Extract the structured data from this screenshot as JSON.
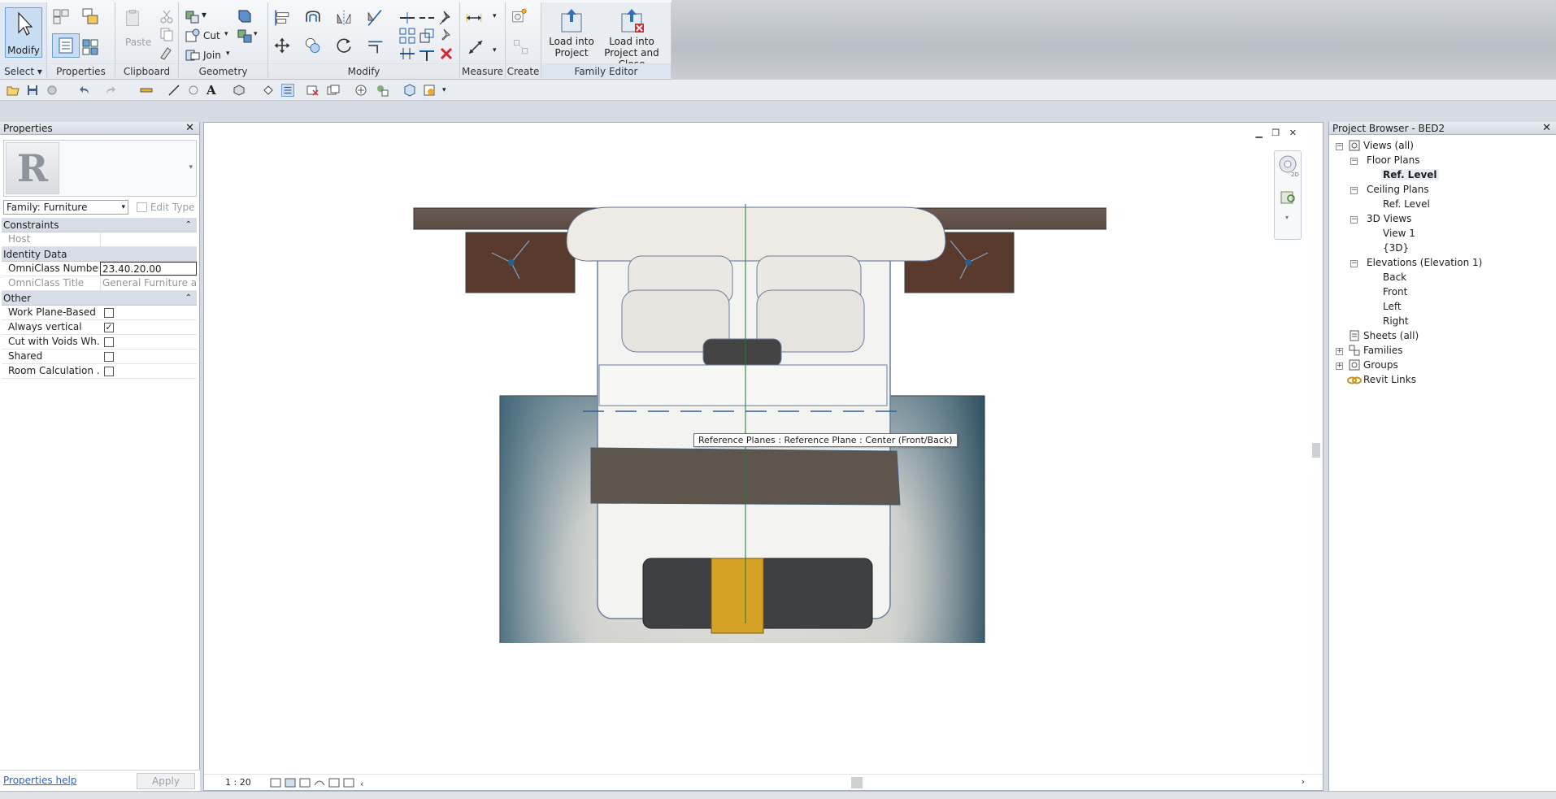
{
  "ribbon": {
    "panels": {
      "select": "Select",
      "properties": "Properties",
      "clipboard": "Clipboard",
      "geometry": "Geometry",
      "modify": "Modify",
      "measure": "Measure",
      "create": "Create",
      "family_editor": "Family Editor"
    },
    "modify_label": "Modify",
    "paste_label": "Paste",
    "cut_label": "Cut",
    "join_label": "Join",
    "load_into_project": "Load into Project",
    "load_into_project_close": "Load into Project and Close"
  },
  "properties": {
    "title": "Properties",
    "type_letter": "R",
    "family_select": "Family: Furniture",
    "edit_type": "Edit Type",
    "groups": {
      "constraints": "Constraints",
      "identity": "Identity Data",
      "other": "Other"
    },
    "rows": {
      "host_label": "Host",
      "host_value": "",
      "omniclass_number_label": "OmniClass Number",
      "omniclass_number_value": "23.40.20.00",
      "omniclass_title_label": "OmniClass Title",
      "omniclass_title_value": "General Furniture an...",
      "work_plane_label": "Work Plane-Based",
      "always_vertical_label": "Always vertical",
      "cut_voids_label": "Cut with Voids Wh...",
      "shared_label": "Shared",
      "room_calc_label": "Room Calculation ..."
    },
    "checks": {
      "work_plane": false,
      "always_vertical": true,
      "cut_voids": false,
      "shared": false,
      "room_calc": false
    },
    "help": "Properties help",
    "apply": "Apply"
  },
  "view": {
    "tooltip": "Reference Planes : Reference Plane : Center (Front/Back)",
    "scale": "1 : 20"
  },
  "browser": {
    "title": "Project Browser - BED2",
    "items": {
      "views_all": "Views (all)",
      "floor_plans": "Floor Plans",
      "ref_level_floor": "Ref. Level",
      "ceiling_plans": "Ceiling Plans",
      "ref_level_ceiling": "Ref. Level",
      "views_3d": "3D Views",
      "view1": "View 1",
      "view_3d": "{3D}",
      "elevations": "Elevations (Elevation 1)",
      "back": "Back",
      "front": "Front",
      "left": "Left",
      "right": "Right",
      "sheets": "Sheets (all)",
      "families": "Families",
      "groups": "Groups",
      "revit_links": "Revit Links"
    }
  }
}
